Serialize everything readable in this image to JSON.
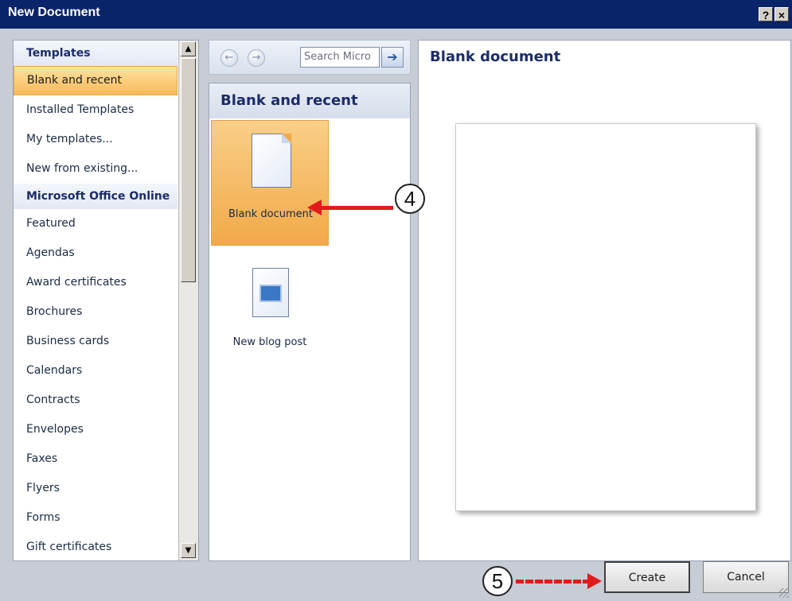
{
  "window": {
    "title": "New Document",
    "help_glyph": "?",
    "close_glyph": "×"
  },
  "left": {
    "items": [
      {
        "label": "Templates",
        "kind": "header"
      },
      {
        "label": "Blank and recent",
        "kind": "selected"
      },
      {
        "label": "Installed Templates",
        "kind": "item"
      },
      {
        "label": "My templates...",
        "kind": "item"
      },
      {
        "label": "New from existing...",
        "kind": "item"
      },
      {
        "label": "Microsoft Office Online",
        "kind": "header"
      },
      {
        "label": "Featured",
        "kind": "item"
      },
      {
        "label": "Agendas",
        "kind": "item"
      },
      {
        "label": "Award certificates",
        "kind": "item"
      },
      {
        "label": "Brochures",
        "kind": "item"
      },
      {
        "label": "Business cards",
        "kind": "item"
      },
      {
        "label": "Calendars",
        "kind": "item"
      },
      {
        "label": "Contracts",
        "kind": "item"
      },
      {
        "label": "Envelopes",
        "kind": "item"
      },
      {
        "label": "Faxes",
        "kind": "item"
      },
      {
        "label": "Flyers",
        "kind": "item"
      },
      {
        "label": "Forms",
        "kind": "item"
      },
      {
        "label": "Gift certificates",
        "kind": "item"
      }
    ],
    "scroll_up": "▲",
    "scroll_down": "▼"
  },
  "toolbar": {
    "back_glyph": "←",
    "forward_glyph": "→",
    "search_placeholder": "Search Micro",
    "search_go_glyph": "➔"
  },
  "middle": {
    "header": "Blank and recent",
    "tiles": [
      {
        "label": "Blank document",
        "icon": "blank-document-icon",
        "selected": true
      },
      {
        "label": "New blog post",
        "icon": "blog-post-icon",
        "selected": false
      }
    ]
  },
  "preview": {
    "title": "Blank document"
  },
  "buttons": {
    "create": "Create",
    "cancel": "Cancel"
  },
  "annotations": {
    "step4": "4",
    "step5": "5",
    "arrow_color": "#e11b1b"
  }
}
